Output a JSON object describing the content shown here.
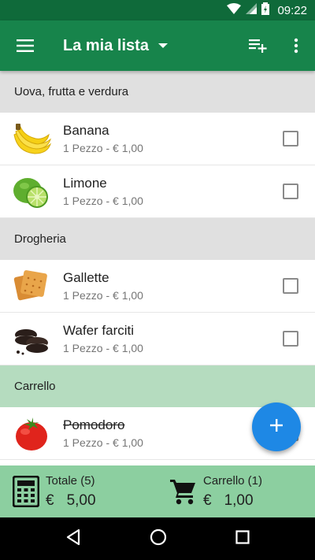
{
  "status_bar": {
    "time": "09:22",
    "battery_icon": "battery-charging-icon",
    "wifi_icon": "wifi-icon",
    "signal_icon": "signal-icon"
  },
  "app_bar": {
    "title": "La mia lista",
    "menu_icon": "menu-icon",
    "add_list_icon": "playlist-add-icon",
    "more_icon": "more-vert-icon"
  },
  "sections": [
    {
      "title": "Uova, frutta e verdura",
      "items": [
        {
          "name": "Banana",
          "detail": "1 Pezzo - € 1,00",
          "icon": "banana-image"
        },
        {
          "name": "Limone",
          "detail": "1 Pezzo - € 1,00",
          "icon": "lime-image"
        }
      ]
    },
    {
      "title": "Drogheria",
      "items": [
        {
          "name": "Gallette",
          "detail": "1 Pezzo - € 1,00",
          "icon": "crackers-image"
        },
        {
          "name": "Wafer farciti",
          "detail": "1 Pezzo - € 1,00",
          "icon": "cookies-image"
        }
      ]
    },
    {
      "title": "Carrello",
      "items": [
        {
          "name": "Pomodoro",
          "detail": "1 Pezzo - € 1,00",
          "icon": "tomato-image"
        }
      ]
    }
  ],
  "fab": {
    "icon": "plus-icon"
  },
  "totals": {
    "total_label": "Totale (5)",
    "total_currency": "€",
    "total_amount": "5,00",
    "cart_label": "Carrello (1)",
    "cart_currency": "€",
    "cart_amount": "1,00"
  },
  "colors": {
    "app_bar": "#17844b",
    "status_bar": "#0f6a3a",
    "fab": "#1e88e5",
    "totals_bar": "#8ccfa0",
    "cart_header": "#b5dcbf"
  }
}
